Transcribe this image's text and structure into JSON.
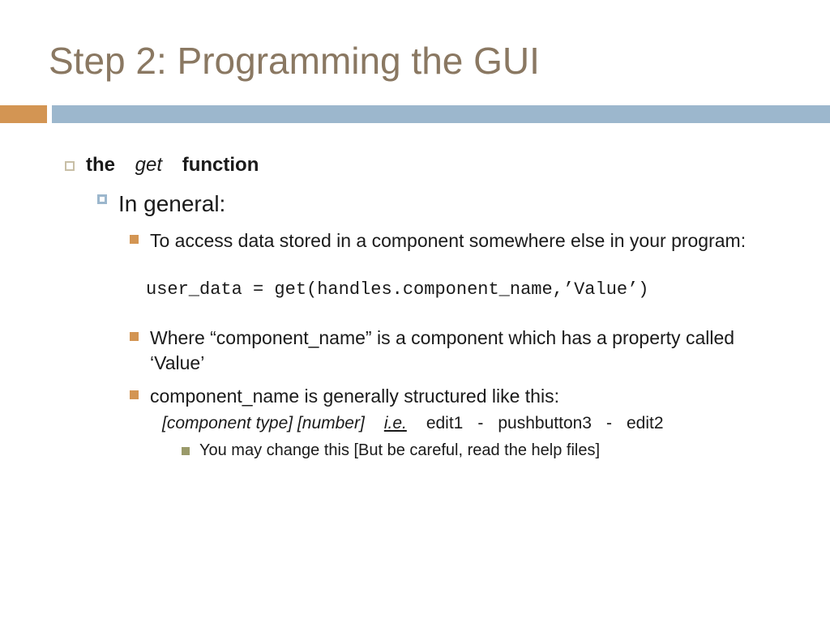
{
  "title": "Step 2: Programming the GUI",
  "l1": {
    "w1": "the",
    "w2": "get",
    "w3": "function"
  },
  "l2": "In general:",
  "l3a": "To access data stored in a component somewhere else in your program:",
  "code": "user_data = get(handles.component_name,’Value’)",
  "l3b": "Where “component_name” is a component which has a property called ‘Value’",
  "l3c": "component_name is generally structured like this:",
  "l4": {
    "pattern": "[component type] [number]",
    "ie": "i.e.",
    "ex1": "edit1",
    "dash": "-",
    "ex2": "pushbutton3",
    "ex3": "edit2"
  },
  "l5": "You may change this [But be careful, read the help files]"
}
